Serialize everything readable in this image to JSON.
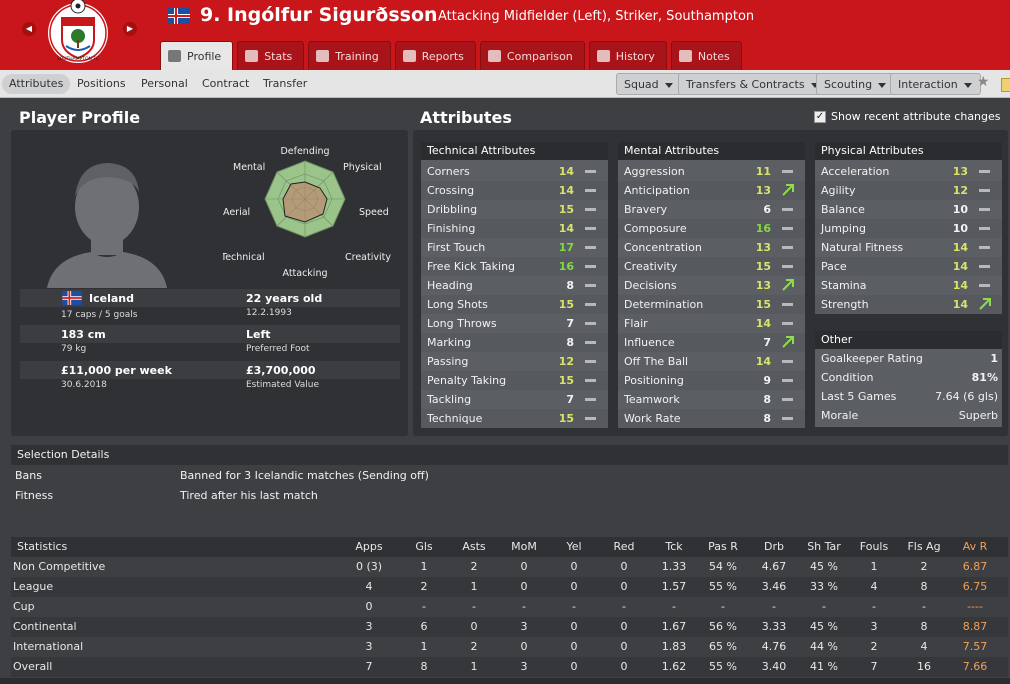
{
  "header": {
    "title": "9. Ingólfur Sigurðsson",
    "subtitle": "Attacking Midfielder (Left), Striker, Southampton",
    "club_name_on_crest": "SOUTHAMPTON FC",
    "prev_icon": "chevron-left-icon",
    "next_icon": "chevron-right-icon"
  },
  "tabs": [
    {
      "label": "Profile",
      "active": true,
      "icon": "profile-icon"
    },
    {
      "label": "Stats",
      "active": false,
      "icon": "stats-icon"
    },
    {
      "label": "Training",
      "active": false,
      "icon": "training-icon"
    },
    {
      "label": "Reports",
      "active": false,
      "icon": "reports-icon"
    },
    {
      "label": "Comparison",
      "active": false,
      "icon": "comparison-icon"
    },
    {
      "label": "History",
      "active": false,
      "icon": "history-icon"
    },
    {
      "label": "Notes",
      "active": false,
      "icon": "notes-icon"
    }
  ],
  "subnav": {
    "tabs": [
      "Attributes",
      "Positions",
      "Personal",
      "Contract",
      "Transfer"
    ],
    "active": "Attributes",
    "menus": [
      "Squad",
      "Transfers & Contracts",
      "Scouting",
      "Interaction"
    ]
  },
  "profile": {
    "heading": "Player Profile",
    "radar_labels": {
      "top": "Defending",
      "tr": "Physical",
      "r": "Speed",
      "br": "Creativity",
      "b": "Attacking",
      "bl": "Technical",
      "l": "Aerial",
      "tl": "Mental"
    },
    "nation": "Iceland",
    "caps": "17 caps / 5 goals",
    "age": "22 years old",
    "dob": "12.2.1993",
    "height": "183 cm",
    "weight": "79 kg",
    "foot": "Left",
    "foot_label": "Preferred Foot",
    "wage": "£11,000 per week",
    "contract_end": "30.6.2018",
    "value": "£3,700,000",
    "value_label": "Estimated Value"
  },
  "attributes": {
    "heading": "Attributes",
    "show_changes_label": "Show recent attribute changes",
    "show_changes_checked": true,
    "technical": {
      "title": "Technical Attributes",
      "items": [
        {
          "name": "Corners",
          "value": "14",
          "trend": "same"
        },
        {
          "name": "Crossing",
          "value": "14",
          "trend": "same"
        },
        {
          "name": "Dribbling",
          "value": "15",
          "trend": "same"
        },
        {
          "name": "Finishing",
          "value": "14",
          "trend": "same"
        },
        {
          "name": "First Touch",
          "value": "17",
          "trend": "same"
        },
        {
          "name": "Free Kick Taking",
          "value": "16",
          "trend": "same"
        },
        {
          "name": "Heading",
          "value": "8",
          "trend": "same"
        },
        {
          "name": "Long Shots",
          "value": "15",
          "trend": "same"
        },
        {
          "name": "Long Throws",
          "value": "7",
          "trend": "same"
        },
        {
          "name": "Marking",
          "value": "8",
          "trend": "same"
        },
        {
          "name": "Passing",
          "value": "12",
          "trend": "same"
        },
        {
          "name": "Penalty Taking",
          "value": "15",
          "trend": "same"
        },
        {
          "name": "Tackling",
          "value": "7",
          "trend": "same"
        },
        {
          "name": "Technique",
          "value": "15",
          "trend": "same"
        }
      ]
    },
    "mental": {
      "title": "Mental Attributes",
      "items": [
        {
          "name": "Aggression",
          "value": "11",
          "trend": "same"
        },
        {
          "name": "Anticipation",
          "value": "13",
          "trend": "up"
        },
        {
          "name": "Bravery",
          "value": "6",
          "trend": "same"
        },
        {
          "name": "Composure",
          "value": "16",
          "trend": "same"
        },
        {
          "name": "Concentration",
          "value": "13",
          "trend": "same"
        },
        {
          "name": "Creativity",
          "value": "15",
          "trend": "same"
        },
        {
          "name": "Decisions",
          "value": "13",
          "trend": "up"
        },
        {
          "name": "Determination",
          "value": "15",
          "trend": "same"
        },
        {
          "name": "Flair",
          "value": "14",
          "trend": "same"
        },
        {
          "name": "Influence",
          "value": "7",
          "trend": "up"
        },
        {
          "name": "Off The Ball",
          "value": "14",
          "trend": "same"
        },
        {
          "name": "Positioning",
          "value": "9",
          "trend": "same"
        },
        {
          "name": "Teamwork",
          "value": "8",
          "trend": "same"
        },
        {
          "name": "Work Rate",
          "value": "8",
          "trend": "same"
        }
      ]
    },
    "physical": {
      "title": "Physical Attributes",
      "items": [
        {
          "name": "Acceleration",
          "value": "13",
          "trend": "same"
        },
        {
          "name": "Agility",
          "value": "12",
          "trend": "same"
        },
        {
          "name": "Balance",
          "value": "10",
          "trend": "same"
        },
        {
          "name": "Jumping",
          "value": "10",
          "trend": "same"
        },
        {
          "name": "Natural Fitness",
          "value": "14",
          "trend": "same"
        },
        {
          "name": "Pace",
          "value": "14",
          "trend": "same"
        },
        {
          "name": "Stamina",
          "value": "14",
          "trend": "same"
        },
        {
          "name": "Strength",
          "value": "14",
          "trend": "up"
        }
      ]
    },
    "other": {
      "title": "Other",
      "items": [
        {
          "name": "Goalkeeper Rating",
          "value": "1"
        },
        {
          "name": "Condition",
          "value": "81%"
        },
        {
          "name": "Last 5 Games",
          "value": "7.64 (6 gls)"
        },
        {
          "name": "Morale",
          "value": "Superb"
        }
      ]
    }
  },
  "selection": {
    "title": "Selection Details",
    "rows": [
      {
        "label": "Bans",
        "value": "Banned for 3 Icelandic matches (Sending off)"
      },
      {
        "label": "Fitness",
        "value": "Tired after his last match"
      }
    ]
  },
  "stats": {
    "title": "Statistics",
    "columns": [
      "Apps",
      "Gls",
      "Asts",
      "MoM",
      "Yel",
      "Red",
      "Tck",
      "Pas R",
      "Drb",
      "Sh Tar",
      "Fouls",
      "Fls Ag",
      "Av R"
    ],
    "rows": [
      {
        "name": "Non Competitive",
        "cells": [
          "0 (3)",
          "1",
          "2",
          "0",
          "0",
          "0",
          "1.33",
          "54 %",
          "4.67",
          "45 %",
          "1",
          "2",
          "6.87"
        ]
      },
      {
        "name": "League",
        "cells": [
          "4",
          "2",
          "1",
          "0",
          "0",
          "0",
          "1.57",
          "55 %",
          "3.46",
          "33 %",
          "4",
          "8",
          "6.75"
        ]
      },
      {
        "name": "Cup",
        "cells": [
          "0",
          "-",
          "-",
          "-",
          "-",
          "-",
          "-",
          "-",
          "-",
          "-",
          "-",
          "-",
          "----"
        ]
      },
      {
        "name": "Continental",
        "cells": [
          "3",
          "6",
          "0",
          "3",
          "0",
          "0",
          "1.67",
          "56 %",
          "3.33",
          "45 %",
          "3",
          "8",
          "8.87"
        ]
      },
      {
        "name": "International",
        "cells": [
          "3",
          "1",
          "2",
          "0",
          "0",
          "0",
          "1.83",
          "65 %",
          "4.76",
          "44 %",
          "2",
          "4",
          "7.57"
        ]
      },
      {
        "name": "Overall",
        "cells": [
          "7",
          "8",
          "1",
          "3",
          "0",
          "0",
          "1.62",
          "55 %",
          "3.40",
          "41 %",
          "7",
          "16",
          "7.66"
        ]
      }
    ]
  },
  "colors": {
    "header_red": "#c8161a",
    "accent_orange": "#f0a15a",
    "attr_green": "#7fdc3e",
    "attr_yellow_green": "#d9e36c"
  }
}
